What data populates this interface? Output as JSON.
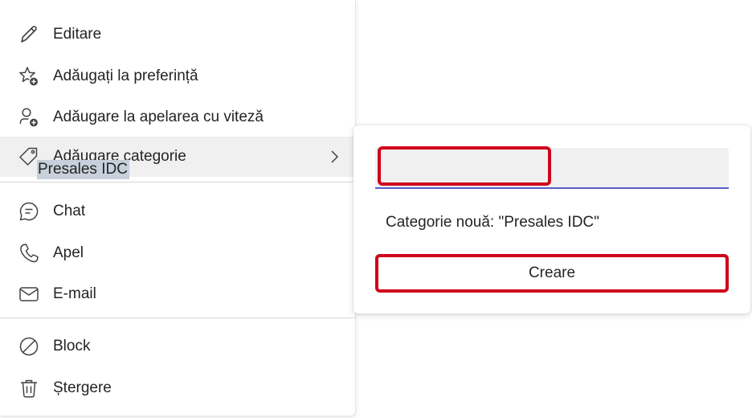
{
  "menu": {
    "items": [
      {
        "label": "Editare",
        "icon": "pencil-icon"
      },
      {
        "label": "Adăugați la preferință",
        "icon": "star-add-icon"
      },
      {
        "label": "Adăugare la apelarea cu viteză",
        "icon": "person-add-icon"
      },
      {
        "label": "Adăugare categorie",
        "icon": "tag-icon"
      },
      {
        "label": "Chat",
        "icon": "chat-icon"
      },
      {
        "label": "Apel",
        "icon": "phone-icon"
      },
      {
        "label": "E-mail",
        "icon": "mail-icon"
      },
      {
        "label": "Block",
        "icon": "block-icon"
      },
      {
        "label": "Ștergere",
        "icon": "trash-icon"
      }
    ]
  },
  "submenu": {
    "input_value": "Presales IDC",
    "new_category_text": "Categorie nouă: \"Presales IDC\"",
    "create_label": "Creare"
  },
  "colors": {
    "accent": "#5b5fc7",
    "highlight": "#d0021b",
    "active_row": "#f0f0f0"
  }
}
